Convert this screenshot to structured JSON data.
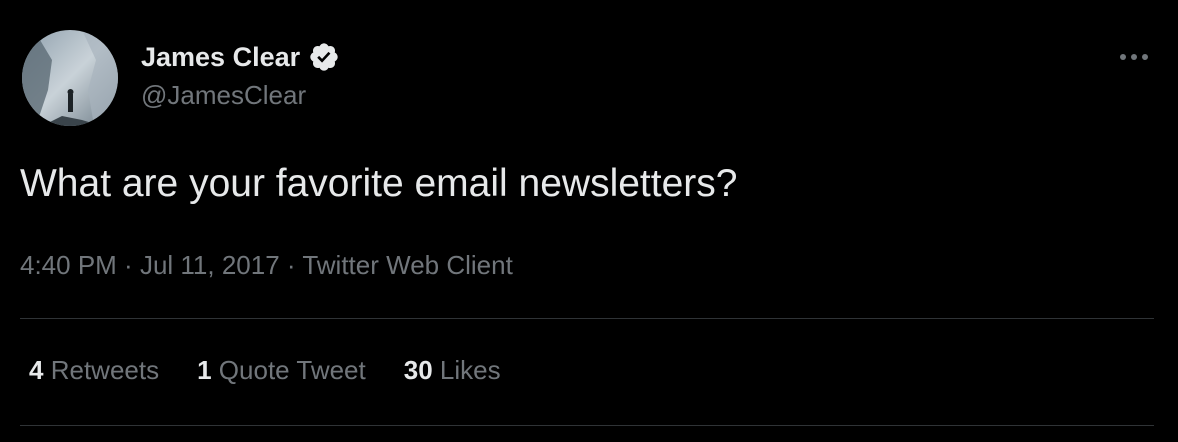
{
  "author": {
    "display_name": "James Clear",
    "handle": "@JamesClear",
    "verified_icon": "verified-badge-icon",
    "avatar_icon": "profile-photo"
  },
  "tweet": {
    "text": "What are your favorite email newsletters?"
  },
  "meta": {
    "time": "4:40 PM",
    "separator1": " · ",
    "date": "Jul 11, 2017",
    "separator2": " · ",
    "source": "Twitter Web Client"
  },
  "stats": {
    "retweets_count": "4",
    "retweets_label": "Retweets",
    "quotes_count": "1",
    "quotes_label": "Quote Tweet",
    "likes_count": "30",
    "likes_label": "Likes"
  },
  "icons": {
    "more": "more-horizontal-icon"
  },
  "colors": {
    "background": "#000000",
    "primary_text": "#e7e9ea",
    "secondary_text": "#71767b",
    "divider": "#2f3336"
  }
}
